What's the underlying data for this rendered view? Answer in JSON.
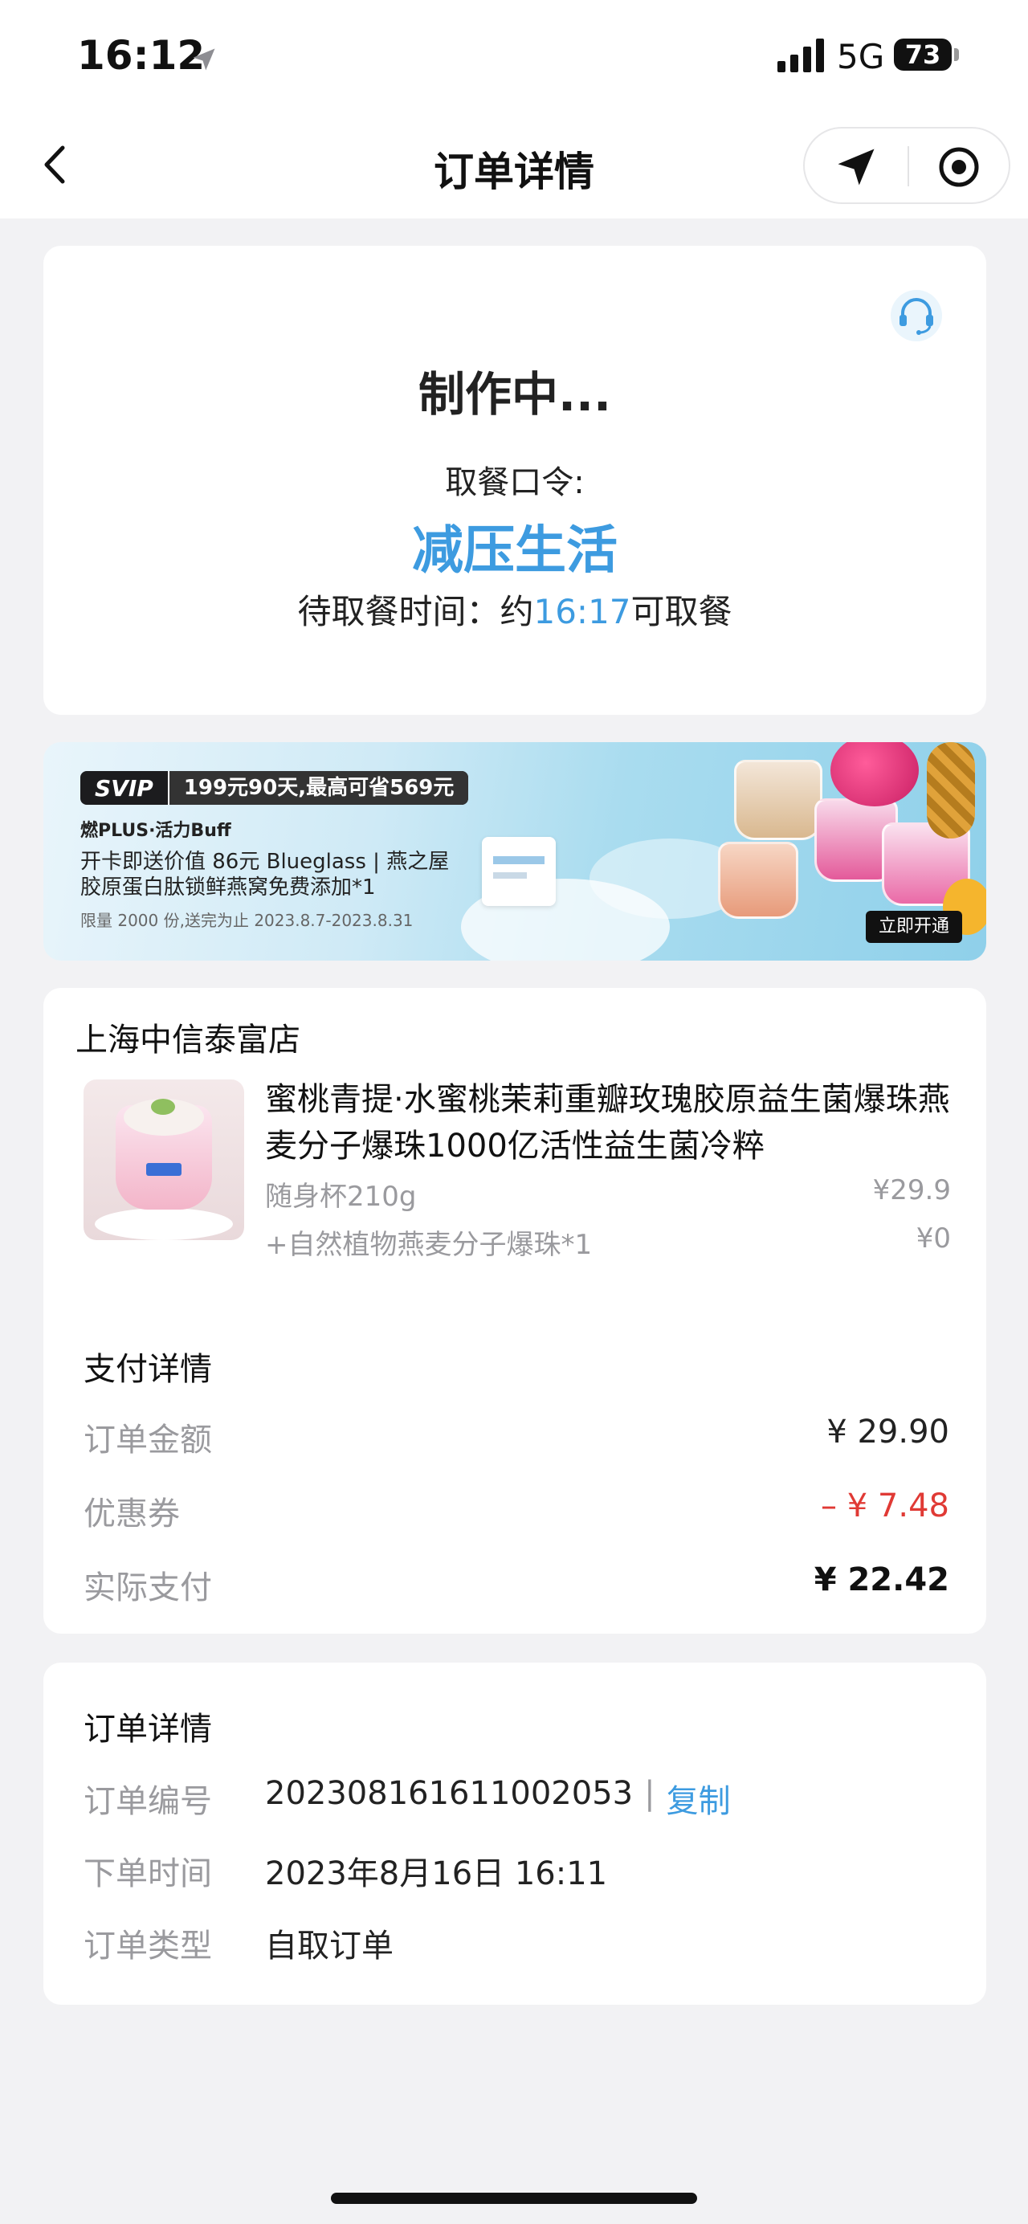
{
  "status_bar": {
    "time": "16:12",
    "network": "5G",
    "battery": "73"
  },
  "nav": {
    "title": "订单详情"
  },
  "status_card": {
    "status": "制作中...",
    "pickup_code_label": "取餐口令:",
    "pickup_code": "减压生活",
    "pickup_time_prefix": "待取餐时间：约",
    "pickup_time": "16:17",
    "pickup_time_suffix": "可取餐"
  },
  "banner": {
    "svip_label": "SVIP",
    "deal_text": "199元90天,最高可省569元",
    "subtitle": "燃PLUS·活力Buff",
    "line1": "开卡即送价值 86元 Blueglass | 燕之屋",
    "line2": "胶原蛋白肽锁鲜燕窝免费添加*1",
    "small_print": "限量 2000 份,送完为止 2023.8.7-2023.8.31",
    "cta": "立即开通"
  },
  "order": {
    "store_name": "上海中信泰富店",
    "product_title": "蜜桃青提·水蜜桃茉莉重瓣玫瑰胶原益生菌爆珠燕麦分子爆珠1000亿活性益生菌冷粹",
    "spec_name": "随身杯210g",
    "spec_price": "¥29.9",
    "addon_name": "+自然植物燕麦分子爆珠*1",
    "addon_price": "¥0"
  },
  "payment": {
    "title": "支付详情",
    "order_amount_label": "订单金额",
    "order_amount": "¥ 29.90",
    "coupon_label": "优惠券",
    "coupon_amount": "– ¥ 7.48",
    "paid_label": "实际支付",
    "paid_amount": "¥ 22.42"
  },
  "details": {
    "title": "订单详情",
    "order_no_label": "订单编号",
    "order_no": "202308161611002053",
    "separator": "|",
    "copy_label": "复制",
    "order_time_label": "下单时间",
    "order_time": "2023年8月16日 16:11",
    "order_type_label": "订单类型",
    "order_type": "自取订单"
  },
  "colors": {
    "accent": "#3d9be0",
    "discount": "#e03a35",
    "background": "#f2f2f4"
  }
}
